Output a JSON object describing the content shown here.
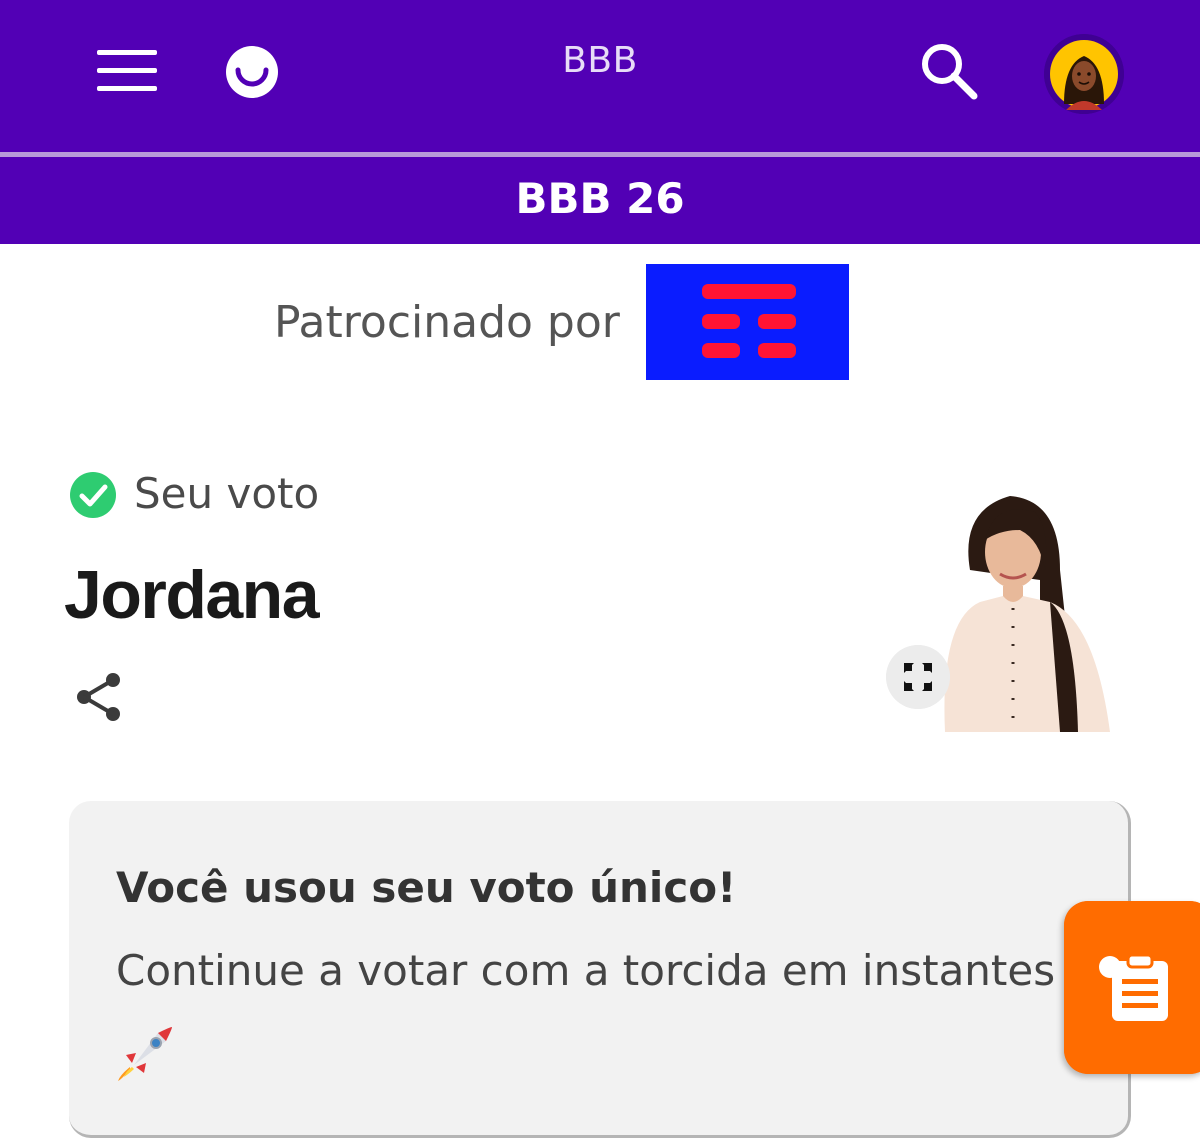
{
  "header": {
    "menu_icon": "hamburger-menu-icon",
    "logo_icon": "smile-logo-icon",
    "title": "BBB",
    "search_icon": "search-icon",
    "avatar_icon": "user-avatar",
    "background_color": "#5200b5"
  },
  "subheader": {
    "title": "BBB 26"
  },
  "sponsor": {
    "label": "Patrocinado por",
    "logo_colors": {
      "background": "#0a1cff",
      "bars": "#ff1434"
    }
  },
  "vote": {
    "status_icon": "check-circle-icon",
    "status_label": "Seu voto",
    "candidate_name": "Jordana",
    "share_icon": "share-icon",
    "expand_icon": "expand-icon"
  },
  "card": {
    "title": "Você usou seu voto único!",
    "message": "Continue a votar com a torcida em instantes",
    "emoji_icon": "rocket-icon"
  },
  "fab": {
    "icon": "clipboard-list-icon",
    "color": "#ff6c00"
  }
}
